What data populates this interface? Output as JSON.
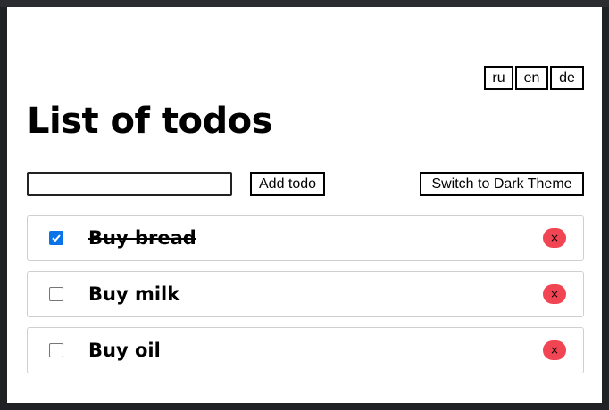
{
  "header": {
    "languages": [
      "ru",
      "en",
      "de"
    ],
    "title": "List of todos"
  },
  "controls": {
    "input_value": "",
    "add_label": "Add todo",
    "theme_label": "Switch to Dark Theme"
  },
  "todos": [
    {
      "text": "Buy bread",
      "done": true
    },
    {
      "text": "Buy milk",
      "done": false
    },
    {
      "text": "Buy oil",
      "done": false
    }
  ],
  "icons": {
    "delete": "close-icon",
    "delete_glyph": "×",
    "delete_color": "#f24553",
    "checkbox_color": "#0b73e8"
  }
}
